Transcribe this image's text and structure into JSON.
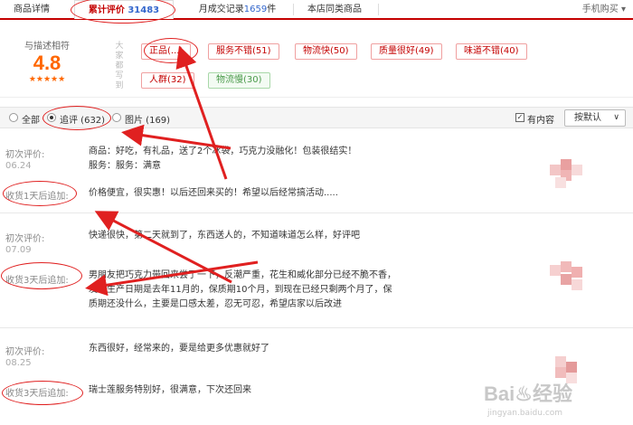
{
  "tabs": {
    "details": "商品详情",
    "reviews_label": "累计评价",
    "reviews_count": "31483",
    "sales_label": "月成交记录",
    "sales_count": "1659",
    "sales_unit": "件",
    "same_store": "本店同类商品",
    "mobile": "手机购买"
  },
  "summary": {
    "label": "与描述相符",
    "score": "4.8",
    "stars": "★★★★★",
    "vertical_label": "大家都写到",
    "tags": [
      {
        "text": "正品(...)",
        "style": "red"
      },
      {
        "text": "服务不错(51)",
        "style": "red"
      },
      {
        "text": "物流快(50)",
        "style": "red"
      },
      {
        "text": "质量很好(49)",
        "style": "red"
      },
      {
        "text": "味道不错(40)",
        "style": "red"
      },
      {
        "text": "人群(32)",
        "style": "red"
      },
      {
        "text": "物流慢(30)",
        "style": "green"
      }
    ]
  },
  "filter": {
    "all": "全部",
    "followup": "追评 (632)",
    "pictures": "图片 (169)",
    "has_content": "有内容",
    "sort": "按默认",
    "has_content_checked": true,
    "selected": "followup"
  },
  "reviews": [
    {
      "first_label": "初次评价:",
      "first_date": "06.24",
      "lines": [
        "商品：好吃，有礼品，送了2个冰袋，巧克力没融化！包装很结实！",
        "服务：服务：满意"
      ],
      "followup_label": "收货1天后追加:",
      "followup_text": "价格便宜，很实惠！以后还回来买的！希望以后经常搞活动....."
    },
    {
      "first_label": "初次评价:",
      "first_date": "07.09",
      "lines": [
        "快递很快，第二天就到了，东西送人的，不知道味道怎么样，好评吧"
      ],
      "followup_label": "收货3天后追加:",
      "followup_text": "男朋友把巧克力带回来尝了一下，反潮严重，花生和威化部分已经不脆不香，发现生产日期是去年11月的，保质期10个月，到现在已经只剩两个月了，保质期还没什么，主要是口感太差，忍无可忍，希望店家以后改进"
    },
    {
      "first_label": "初次评价:",
      "first_date": "08.25",
      "lines": [
        "东西很好，经常来的，要是给更多优惠就好了"
      ],
      "followup_label": "收货3天后追加:",
      "followup_text": "瑞士莲服务特别好，很满意，下次还回来"
    }
  ],
  "watermark": {
    "main": "Bai♨经验",
    "sub": "jingyan.baidu.com"
  },
  "colors": {
    "accent": "#c40000",
    "score": "#ff6600",
    "annotation": "#e02020"
  }
}
